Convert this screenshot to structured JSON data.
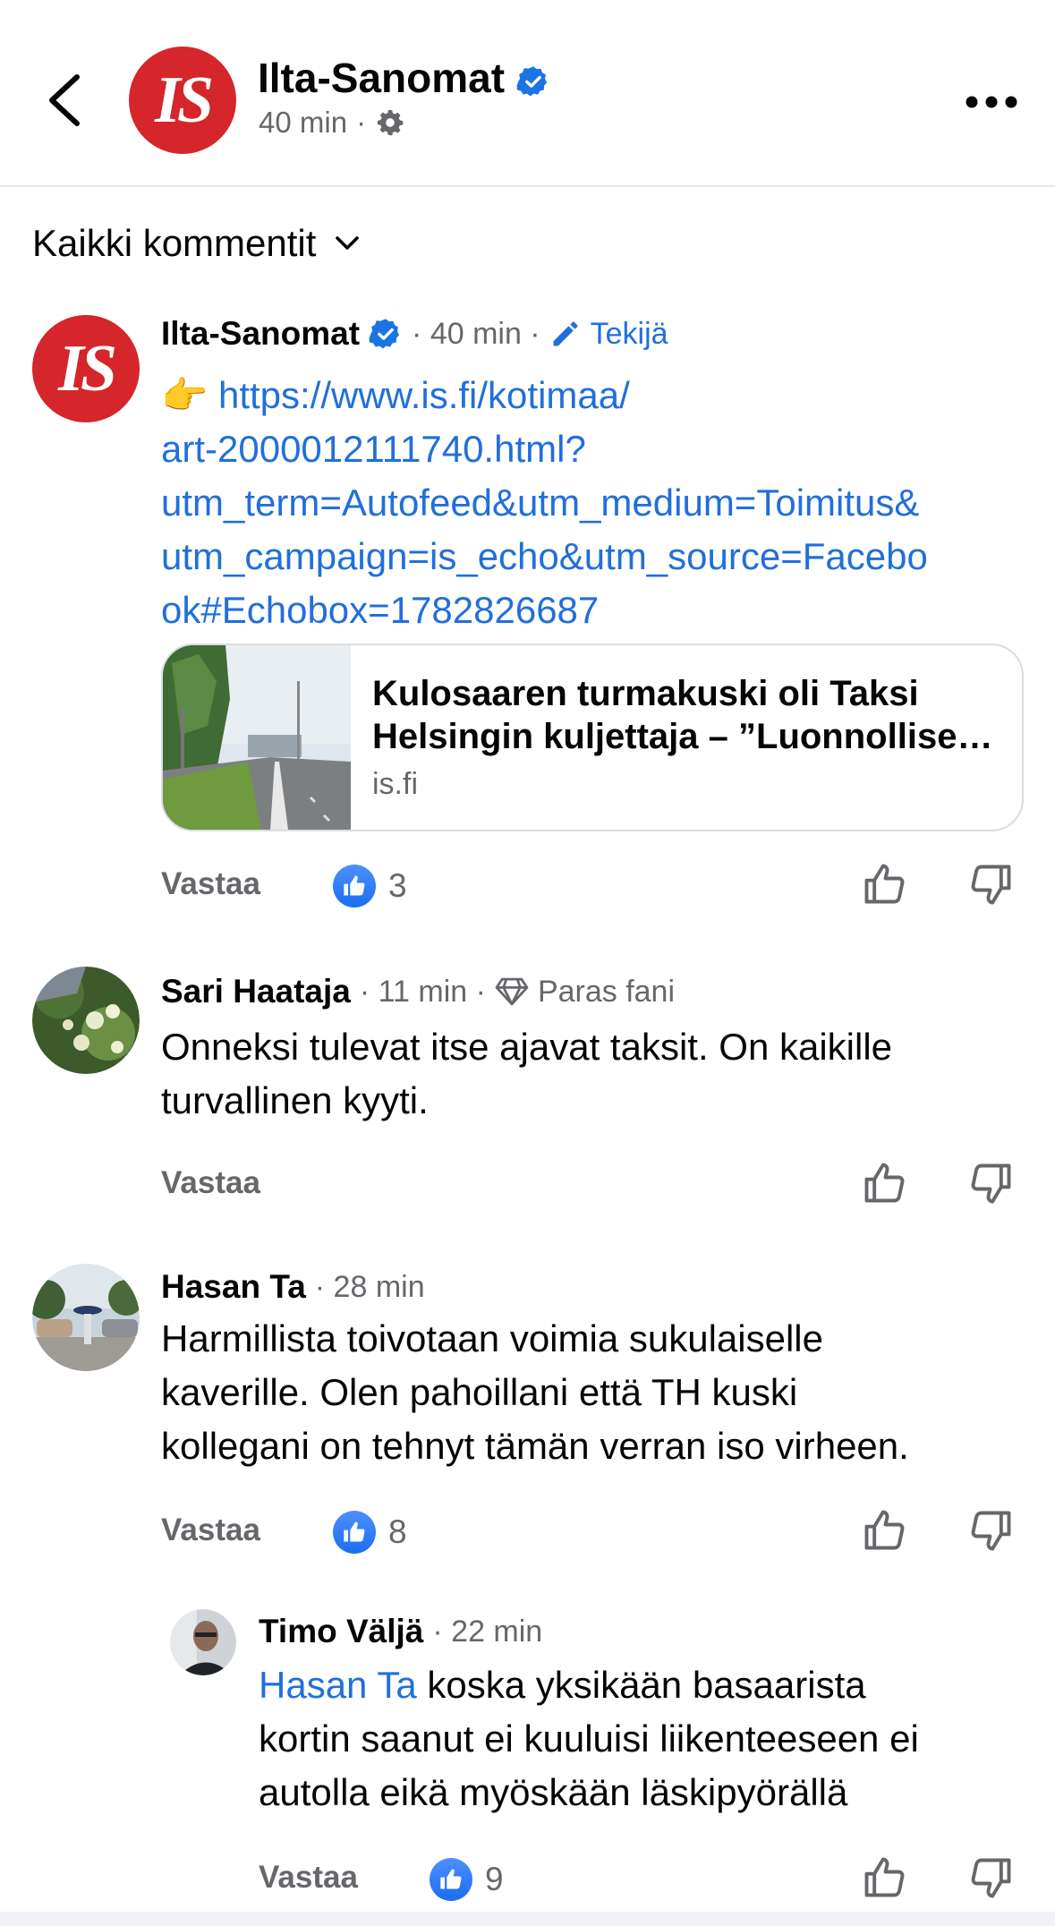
{
  "header": {
    "page_name": "Ilta-Sanomat",
    "logo_text": "IS",
    "time": "40 min",
    "separator": "·",
    "icons": {
      "back": "chevron-left-icon",
      "verified": "verified-badge-icon",
      "privacy": "gear-icon",
      "more": "more-dots-icon"
    }
  },
  "filter": {
    "label": "Kaikki kommentit",
    "icon": "chevron-down-icon"
  },
  "colors": {
    "accent": "#216fdb",
    "verified": "#1b74e4",
    "logo_red": "#d4262b",
    "secondary_text": "#65676b"
  },
  "comments": [
    {
      "author": "Ilta-Sanomat",
      "time": "· 40 min ·",
      "badge": "Tekijä",
      "badge_icon": "pencil-icon",
      "emoji": "👉",
      "link_lines": [
        "https://www.is.fi/kotimaa/",
        "art-2000012111740.html?",
        "utm_term=Autofeed&utm_medium=Toimitus&",
        "utm_campaign=is_echo&utm_source=Facebo",
        "ok#Echobox=1782826687"
      ],
      "card": {
        "title_line1": "Kulosaaren turmakuski oli Taksi",
        "title_line2": "Helsingin kuljettaja – ”Luonnollisesti",
        "domain": "is.fi"
      },
      "reply_label": "Vastaa",
      "likes": "3"
    },
    {
      "author": "Sari Haataja",
      "time": "· 11 min ·",
      "badge": "Paras fani",
      "badge_icon": "diamond-icon",
      "text_lines": [
        "Onneksi tulevat itse ajavat taksit. On kaikille",
        "turvallinen kyyti."
      ],
      "reply_label": "Vastaa"
    },
    {
      "author": "Hasan Ta",
      "time": "· 28 min",
      "text_lines": [
        "Harmillista toivotaan voimia sukulaiselle",
        "kaverille. Olen pahoillani että TH kuski",
        "kollegani on tehnyt tämän verran iso virheen."
      ],
      "reply_label": "Vastaa",
      "likes": "8"
    },
    {
      "author": "Timo Väljä",
      "time": "· 22 min",
      "mention": "Hasan Ta",
      "text_lines": [
        " koska yksikään basaarista",
        "kortin saanut ei kuuluisi liikenteeseen ei",
        "autolla eikä myöskään läskipyörällä"
      ],
      "reply_label": "Vastaa",
      "likes": "9"
    }
  ]
}
